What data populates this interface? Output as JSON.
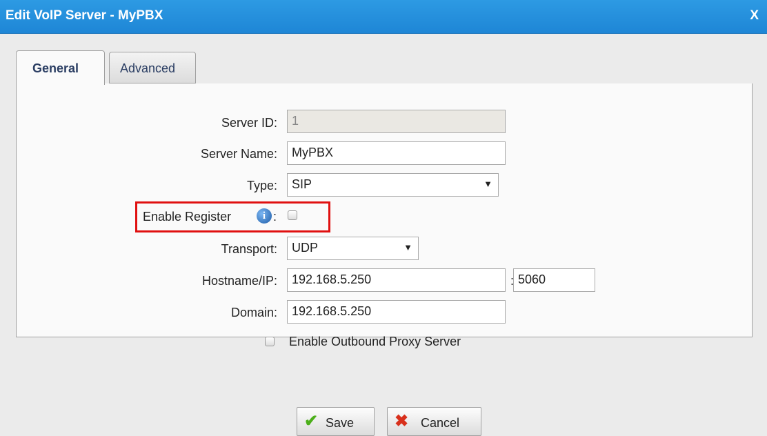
{
  "window": {
    "title": "Edit VoIP Server - MyPBX",
    "close_label": "X"
  },
  "tabs": [
    {
      "label": "General",
      "active": true
    },
    {
      "label": "Advanced",
      "active": false
    }
  ],
  "form": {
    "server_id": {
      "label": "Server ID:",
      "value": "1",
      "disabled": true
    },
    "server_name": {
      "label": "Server Name:",
      "value": "MyPBX"
    },
    "type": {
      "label": "Type:",
      "value": "SIP"
    },
    "enable_register": {
      "label": "Enable Register",
      "colon": ":",
      "checked": false,
      "info_glyph": "i"
    },
    "transport": {
      "label": "Transport:",
      "value": "UDP"
    },
    "hostname": {
      "label": "Hostname/IP:",
      "value": "192.168.5.250",
      "port_sep": ":",
      "port": "5060"
    },
    "domain": {
      "label": "Domain:",
      "value": "192.168.5.250"
    },
    "outbound_proxy": {
      "label": "Enable Outbound Proxy Server",
      "checked": false
    }
  },
  "buttons": {
    "save": {
      "label": "Save",
      "icon": "checkmark-icon"
    },
    "cancel": {
      "label": "Cancel",
      "icon": "x-icon"
    }
  },
  "colors": {
    "titlebar": "#2d9ae3",
    "highlight": "#e01010",
    "save_icon": "#4caf1a",
    "cancel_icon": "#d8301c"
  }
}
